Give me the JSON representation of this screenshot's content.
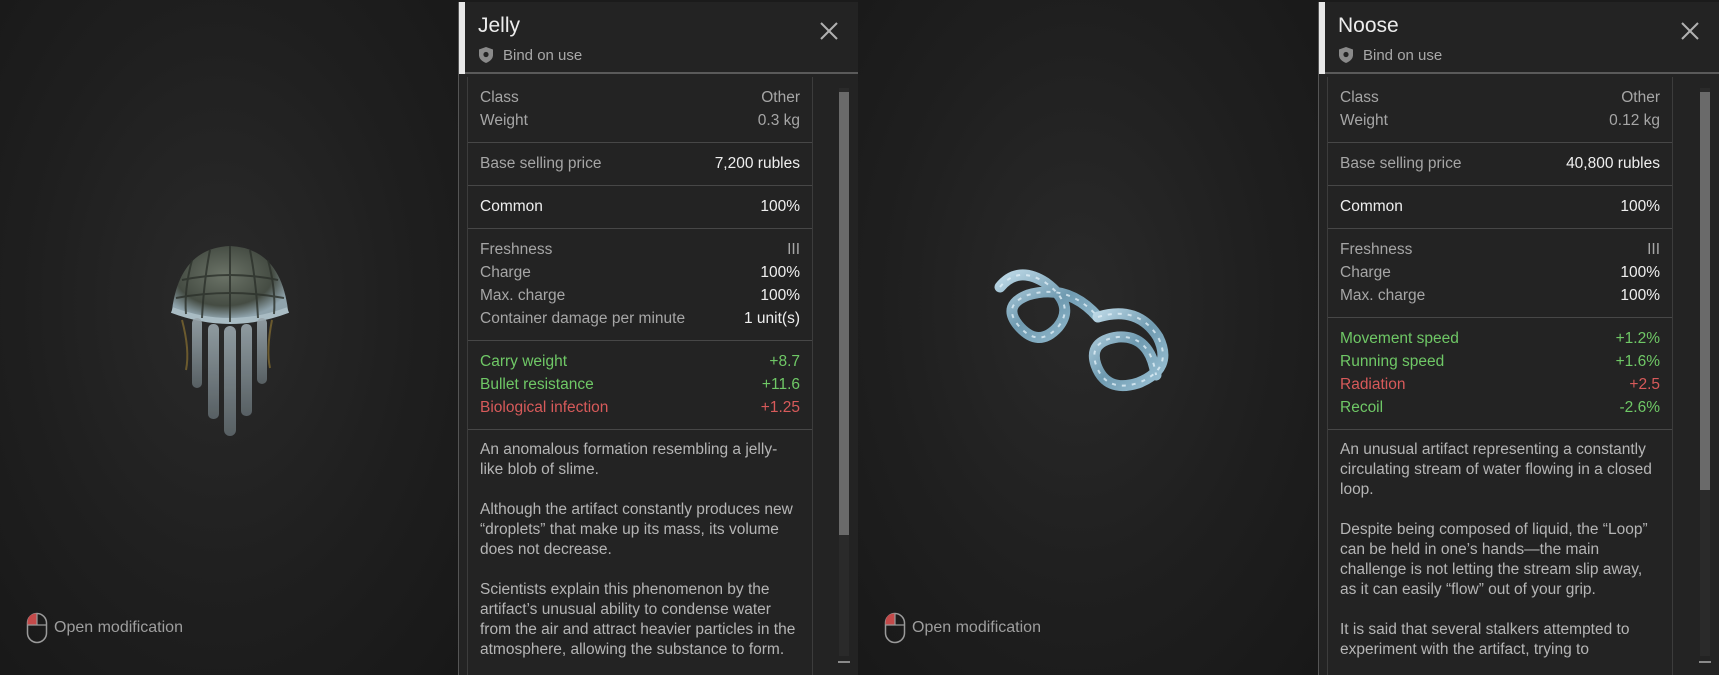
{
  "cards": [
    {
      "title": "Jelly",
      "bind_text": "Bind on use",
      "open_mod": "Open modification",
      "class_label": "Class",
      "class_value": "Other",
      "weight_label": "Weight",
      "weight_value": "0.3 kg",
      "price_label": "Base selling price",
      "price_value": "7,200 rubles",
      "rarity_label": "Common",
      "rarity_value": "100%",
      "freshness_label": "Freshness",
      "freshness_value": "III",
      "charge_label": "Charge",
      "charge_value": "100%",
      "maxcharge_label": "Max. charge",
      "maxcharge_value": "100%",
      "containerdmg_label": "Container damage per minute",
      "containerdmg_value": "1 unit(s)",
      "stats": [
        {
          "label": "Carry weight",
          "value": "+8.7",
          "kind": "pos"
        },
        {
          "label": "Bullet resistance",
          "value": "+11.6",
          "kind": "pos"
        },
        {
          "label": "Biological infection",
          "value": "+1.25",
          "kind": "neg"
        }
      ],
      "desc": [
        "An anomalous formation resembling a jelly-like blob of slime.",
        "Although the artifact constantly produces new “droplets” that make up its mass, its volume does not decrease.",
        "Scientists explain this phenomenon by the artifact’s unusual ability to condense water from the air and attract heavier particles in the atmosphere, allowing the substance to form."
      ],
      "scroll_fraction": 0.78
    },
    {
      "title": "Noose",
      "bind_text": "Bind on use",
      "open_mod": "Open modification",
      "class_label": "Class",
      "class_value": "Other",
      "weight_label": "Weight",
      "weight_value": "0.12 kg",
      "price_label": "Base selling price",
      "price_value": "40,800 rubles",
      "rarity_label": "Common",
      "rarity_value": "100%",
      "freshness_label": "Freshness",
      "freshness_value": "III",
      "charge_label": "Charge",
      "charge_value": "100%",
      "maxcharge_label": "Max. charge",
      "maxcharge_value": "100%",
      "stats": [
        {
          "label": "Movement speed",
          "value": "+1.2%",
          "kind": "pos"
        },
        {
          "label": "Running speed",
          "value": "+1.6%",
          "kind": "pos"
        },
        {
          "label": "Radiation",
          "value": "+2.5",
          "kind": "neg"
        },
        {
          "label": "Recoil",
          "value": "-2.6%",
          "kind": "pos"
        }
      ],
      "desc": [
        "An unusual artifact representing a constantly circulating stream of water flowing in a closed loop.",
        "Despite being composed of liquid, the “Loop” can be held in one’s hands—the main challenge is not letting the stream slip away, as it can easily “flow” out of your grip.",
        "It is said that several stalkers attempted to experiment with the artifact, trying to"
      ],
      "scroll_fraction": 0.7
    }
  ],
  "colors": {
    "positive": "#6fc866",
    "negative": "#d75a5a",
    "accent": "#e8e8e8"
  }
}
